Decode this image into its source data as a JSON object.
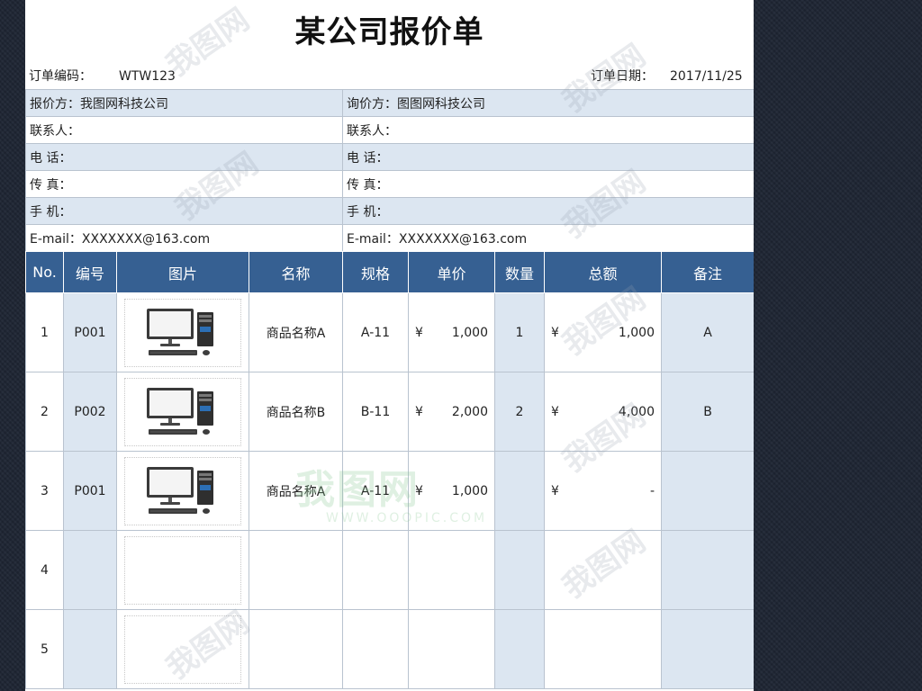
{
  "document": {
    "title": "某公司报价单",
    "order_no_label": "订单编码：",
    "order_no": "WTW123",
    "order_date_label": "订单日期：",
    "order_date": "2017/11/25"
  },
  "parties": {
    "seller": {
      "label": "报价方：我图网科技公司",
      "contact": "联系人：",
      "phone": "电  话：",
      "fax": "传  真：",
      "mobile": "手  机：",
      "email": "E-mail：XXXXXXX@163.com"
    },
    "buyer": {
      "label": "询价方：图图网科技公司",
      "contact": "联系人：",
      "phone": "电  话：",
      "fax": "传  真：",
      "mobile": "手  机：",
      "email": "E-mail：XXXXXXX@163.com"
    }
  },
  "items_table": {
    "headers": [
      "No.",
      "编号",
      "图片",
      "名称",
      "规格",
      "单价",
      "数量",
      "总额",
      "备注"
    ],
    "rows": [
      {
        "no": "1",
        "code": "P001",
        "has_image": true,
        "name": "商品名称A",
        "spec": "A-11",
        "currency": "¥",
        "unit_price": "1,000",
        "qty": "1",
        "total_currency": "¥",
        "total": "1,000",
        "note": "A"
      },
      {
        "no": "2",
        "code": "P002",
        "has_image": true,
        "name": "商品名称B",
        "spec": "B-11",
        "currency": "¥",
        "unit_price": "2,000",
        "qty": "2",
        "total_currency": "¥",
        "total": "4,000",
        "note": "B"
      },
      {
        "no": "3",
        "code": "P001",
        "has_image": true,
        "name": "商品名称A",
        "spec": "A-11",
        "currency": "¥",
        "unit_price": "1,000",
        "qty": "",
        "total_currency": "¥",
        "total": "-",
        "note": ""
      },
      {
        "no": "4",
        "code": "",
        "has_image": false,
        "name": "",
        "spec": "",
        "currency": "",
        "unit_price": "",
        "qty": "",
        "total_currency": "",
        "total": "",
        "note": ""
      },
      {
        "no": "5",
        "code": "",
        "has_image": false,
        "name": "",
        "spec": "",
        "currency": "",
        "unit_price": "",
        "qty": "",
        "total_currency": "",
        "total": "",
        "note": ""
      }
    ]
  },
  "watermark": {
    "brand": "我图网",
    "url": "WWW.OOOPIC.COM"
  },
  "colors": {
    "header_bg": "#366092",
    "shade_bg": "#dce6f1",
    "page_bg": "#1e2533"
  }
}
